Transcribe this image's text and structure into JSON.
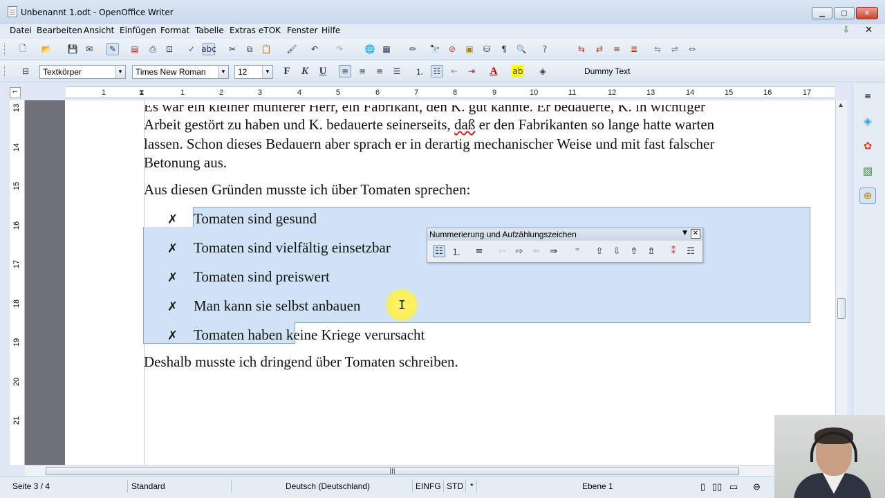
{
  "window": {
    "title": "Unbenannt 1.odt - OpenOffice Writer",
    "minimize_icon": "minimize-icon",
    "maximize_icon": "maximize-icon",
    "close_icon": "close-icon"
  },
  "menu": {
    "items": [
      "Datei",
      "Bearbeiten",
      "Ansicht",
      "Einfügen",
      "Format",
      "Tabelle",
      "Extras",
      "eTOK",
      "Fenster",
      "Hilfe"
    ]
  },
  "format_toolbar": {
    "paragraph_style": "Textkörper",
    "font_name": "Times New Roman",
    "font_size": "12",
    "bold_label": "F",
    "italic_label": "K",
    "underline_label": "U",
    "dummy_text": "Dummy Text"
  },
  "ruler": {
    "labels": [
      "1",
      "1",
      "2",
      "3",
      "4",
      "5",
      "6",
      "7",
      "8",
      "9",
      "10",
      "11",
      "12",
      "13",
      "14",
      "15",
      "16",
      "17"
    ],
    "vertical_labels": [
      "13",
      "14",
      "15",
      "16",
      "17",
      "18",
      "19",
      "20",
      "21"
    ]
  },
  "document": {
    "para1_line1": "Es war ein kleiner munterer Herr, ein Fabrikant, den K. gut kannte. Er bedauerte, K. in wichtiger",
    "para1_line2_before": "Arbeit gestört zu haben und K. bedauerte seinerseits,",
    "para1_line2_misspelled": "daß",
    "para1_line2_after": "er den Fabrikanten so lange hatte warten",
    "para1_line3": "lassen. Schon dieses Bedauern aber sprach er in derartig mechanischer Weise und mit fast falscher",
    "para1_line4": "Betonung aus.",
    "para2": "Aus diesen Gründen musste ich über Tomaten sprechen:",
    "bullet_symbol": "✗",
    "list_items": [
      "Tomaten sind gesund",
      "Tomaten sind vielfältig einsetzbar",
      "Tomaten sind preiswert",
      "Man kann sie selbst anbauen",
      "Tomaten haben keine Kriege verursacht"
    ],
    "para3": "Deshalb musste ich dringend über Tomaten schreiben."
  },
  "floating_toolbar": {
    "title": "Nummerierung und Aufzählungszeichen",
    "close_label": "✕"
  },
  "statusbar": {
    "page": "Seite 3 / 4",
    "style": "Standard",
    "language": "Deutsch (Deutschland)",
    "insert_mode": "EINFG",
    "selection_mode": "STD",
    "modified": "*",
    "level": "Ebene 1"
  },
  "colors": {
    "selection": "#cfe2f6",
    "cursor_highlight": "#fbef5a",
    "spellcheck": "#dd2222"
  }
}
